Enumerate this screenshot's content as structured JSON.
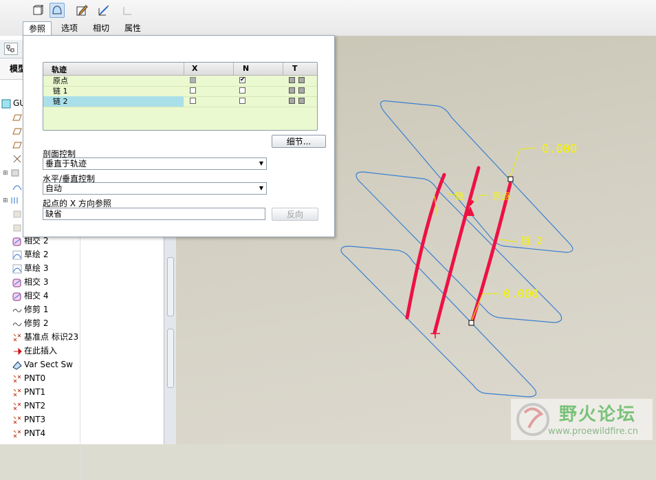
{
  "toolbar": {
    "icons": [
      "solid-icon",
      "surface-icon",
      "sketch-edit-icon",
      "section-icon",
      "unused-icon"
    ],
    "tabs": [
      {
        "label": "参照",
        "active": true
      },
      {
        "label": "选项"
      },
      {
        "label": "相切"
      },
      {
        "label": "属性"
      }
    ]
  },
  "model_tree": {
    "header": "模型",
    "root": "GU",
    "items": [
      {
        "icon": "intersect-icon",
        "label": "相交 2"
      },
      {
        "icon": "sketch-icon",
        "label": "草绘 2"
      },
      {
        "icon": "sketch-icon",
        "label": "草绘 3"
      },
      {
        "icon": "intersect-icon",
        "label": "相交 3"
      },
      {
        "icon": "intersect-icon",
        "label": "相交 4"
      },
      {
        "icon": "trim-icon",
        "label": "修剪 1"
      },
      {
        "icon": "trim-icon",
        "label": "修剪 2"
      },
      {
        "icon": "datum-point-icon",
        "label": "基准点 标识23"
      },
      {
        "icon": "insert-here-icon",
        "label": "在此插入"
      },
      {
        "icon": "var-sect-sweep-icon",
        "label": "Var Sect Sw"
      },
      {
        "icon": "datum-point-icon",
        "label": "PNT0"
      },
      {
        "icon": "datum-point-icon",
        "label": "PNT1"
      },
      {
        "icon": "datum-point-icon",
        "label": "PNT2"
      },
      {
        "icon": "datum-point-icon",
        "label": "PNT3"
      },
      {
        "icon": "datum-point-icon",
        "label": "PNT4"
      }
    ]
  },
  "panel": {
    "grid": {
      "headers": [
        "轨迹",
        "X",
        "N",
        "T"
      ],
      "rows": [
        {
          "name": "原点",
          "x": "disabled",
          "n": true,
          "selected": false
        },
        {
          "name": "链 1",
          "x": false,
          "n": false,
          "selected": false
        },
        {
          "name": "链 2",
          "x": false,
          "n": false,
          "selected": true
        }
      ]
    },
    "details_button": "细节...",
    "section_control_label": "剖面控制",
    "section_control_value": "垂直于轨迹",
    "hv_control_label": "水平/垂直控制",
    "hv_control_value": "自动",
    "x_dir_label": "起点的 X 方向参照",
    "x_dir_value": "缺省",
    "flip_button": "反向"
  },
  "viewport": {
    "labels": {
      "value_top": "0.000",
      "value_bottom": "0.000",
      "chain1": "链",
      "origin": "原点",
      "chain2": "链 2"
    },
    "colors": {
      "trajectory": "#ee1144",
      "surface_edge": "#3a7fd0",
      "annotation": "#f5f500"
    }
  },
  "watermark": {
    "title": "野火论坛",
    "url": "www.proewildfire.cn"
  }
}
